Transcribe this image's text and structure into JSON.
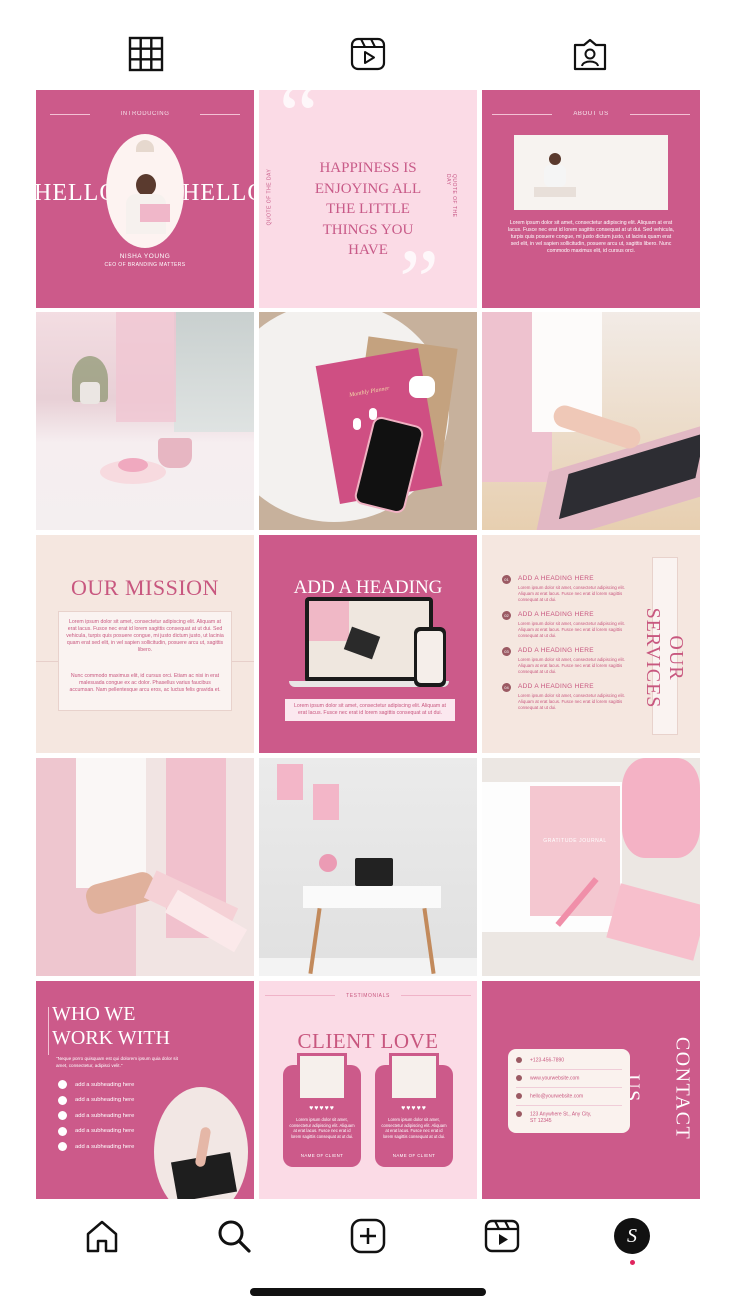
{
  "tabs": {
    "grid": "grid-icon",
    "reels": "reels-icon",
    "tagged": "tagged-icon"
  },
  "t1": {
    "intro": "INTRODUCING",
    "hello_left": "HELLO",
    "hello_right": "HELLO",
    "name": "NISHA YOUNG",
    "role": "CEO OF BRANDING MATTERS"
  },
  "t2": {
    "quote": "HAPPINESS IS ENJOYING ALL THE LITTLE THINGS YOU HAVE",
    "side": "QUOTE OF THE DAY"
  },
  "t3": {
    "title": "ABOUT US",
    "body": "Lorem ipsum dolor sit amet, consectetur adipiscing elit. Aliquam at erat lacus. Fusce nec erat id lorem sagittis consequat at ut dui. Sed vehicula, turpis quis posuere congue, mi justo dictum justo, ut lacinia quam erat sed elit, in vel sapien sollicitudin, posuere arcu ut, sagittis libero. Nunc commodo maximus elit, id cursus orci."
  },
  "t4": {
    "alt": "pink-desk-photo"
  },
  "t5": {
    "notebook": "Monthly Planner"
  },
  "t6": {
    "alt": "laptop-typing-photo"
  },
  "t7": {
    "title": "OUR MISSION",
    "body1": "Lorem ipsum dolor sit amet, consectetur adipiscing elit. Aliquam at erat lacus. Fusce nec erat id lorem sagittis consequat at ut dui. Sed vehicula, turpis quis posuere congue, mi justo dictum justo, ut lacinia quam erat sed elit, in vel sapien sollicitudin, posuere arcu ut, sagittis libero.",
    "body2": "Nunc commodo maximus elit, id cursus orci. Etiam ac nisi in erat malesuada congue ex ac dolor. Phasellus varius faucibus accumsan. Nam pellentesque arcu eros, ac luctus felis gravida et."
  },
  "t8": {
    "title": "ADD A HEADING",
    "body": "Lorem ipsum dolor sit amet, consectetur adipiscing elit. Aliquam at erat lacus. Fusce nec erat id lorem sagittis consequat at ut dui."
  },
  "t9": {
    "title": "OUR SERVICES",
    "items": [
      {
        "num": "01",
        "head": "ADD A HEADING HERE",
        "body": "Lorem ipsum dolor sit amet, consectetur adipiscing elit. Aliquam at erat lacus. Fusce nec erat id lorem sagittis consequat at ut dui."
      },
      {
        "num": "02",
        "head": "ADD A HEADING HERE",
        "body": "Lorem ipsum dolor sit amet, consectetur adipiscing elit. Aliquam at erat lacus. Fusce nec erat id lorem sagittis consequat at ut dui."
      },
      {
        "num": "03",
        "head": "ADD A HEADING HERE",
        "body": "Lorem ipsum dolor sit amet, consectetur adipiscing elit. Aliquam at erat lacus. Fusce nec erat id lorem sagittis consequat at ut dui."
      },
      {
        "num": "04",
        "head": "ADD A HEADING HERE",
        "body": "Lorem ipsum dolor sit amet, consectetur adipiscing elit. Aliquam at erat lacus. Fusce nec erat id lorem sagittis consequat at ut dui."
      }
    ]
  },
  "t10": {
    "alt": "swatch-photo"
  },
  "t11": {
    "alt": "desk-photo"
  },
  "t12": {
    "journal": "GRATITUDE JOURNAL"
  },
  "t13": {
    "title1": "WHO WE",
    "title2": "WORK WITH",
    "quote": "\"Neque porro quisquam est qui dolorem ipsum quia dolor sit amet, consectetur, adipisci velit.\"",
    "items": [
      "add a subheading here",
      "add a subheading here",
      "add a subheading here",
      "add a subheading here",
      "add a subheading here"
    ]
  },
  "t14": {
    "label": "TESTIMONIALS",
    "title": "CLIENT LOVE",
    "hearts": "♥♥♥♥♥",
    "body": "Lorem ipsum dolor sit amet, consectetur adipiscing elit. Aliquam at erat lacus. Fusce nec erat id lorem sagittis consequat at ut dui.",
    "name": "NAME OF CLIENT"
  },
  "t15": {
    "title1": "CONTACT",
    "title2": "US",
    "phone": "+123-456-7890",
    "web": "www.yourwebsite.com",
    "email": "hello@yourwebsite.com",
    "addr1": "123 Anywhere St., Any City,",
    "addr2": "ST 12345"
  },
  "nav": {
    "home": "home-icon",
    "search": "search-icon",
    "create": "create-icon",
    "reels": "reels-icon",
    "profile": "S"
  },
  "colors": {
    "pink": "#cc5a8a",
    "light_pink": "#fbdbe6",
    "cream": "#f5e7e0"
  }
}
